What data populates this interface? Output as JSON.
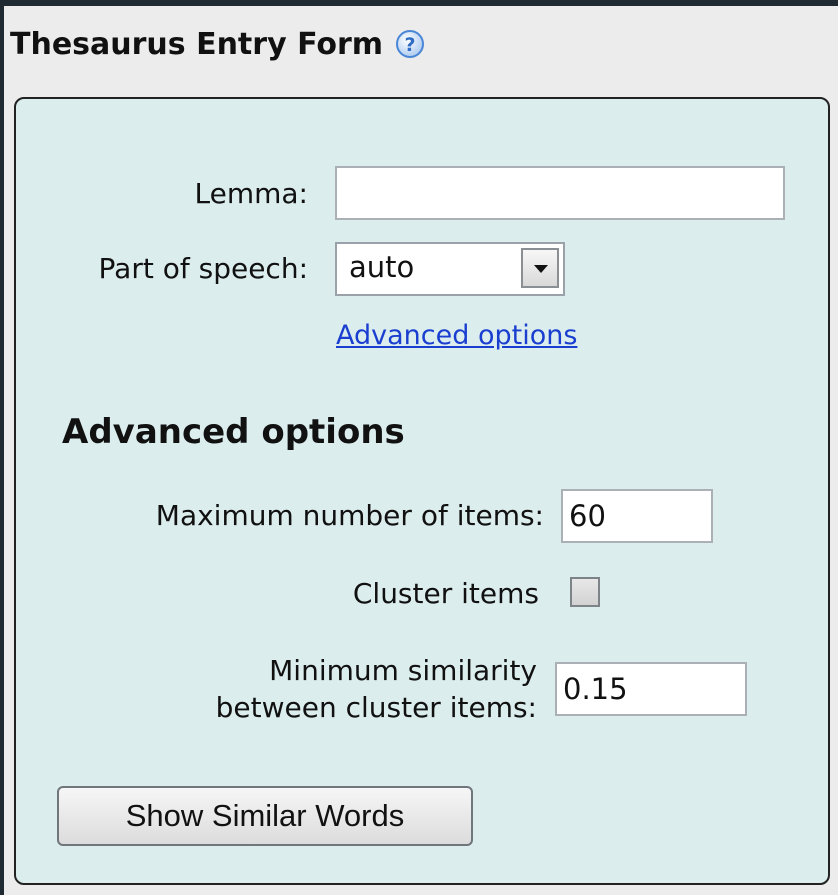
{
  "form": {
    "title": "Thesaurus Entry Form",
    "help_icon": "question-circle-icon",
    "lemma": {
      "label": "Lemma:",
      "value": ""
    },
    "part_of_speech": {
      "label": "Part of speech:",
      "selected": "auto"
    },
    "advanced_link": "Advanced options",
    "advanced": {
      "heading": "Advanced options",
      "max_items": {
        "label": "Maximum number of items:",
        "value": "60"
      },
      "cluster_items": {
        "label": "Cluster items",
        "checked": false
      },
      "min_similarity": {
        "label_line1": "Minimum similarity",
        "label_line2": "between cluster items:",
        "value": "0.15"
      }
    },
    "submit_label": "Show Similar Words"
  },
  "colors": {
    "panel_background": "#dcedee",
    "link": "#1a3fd0",
    "help_icon": "#4a86d6"
  }
}
